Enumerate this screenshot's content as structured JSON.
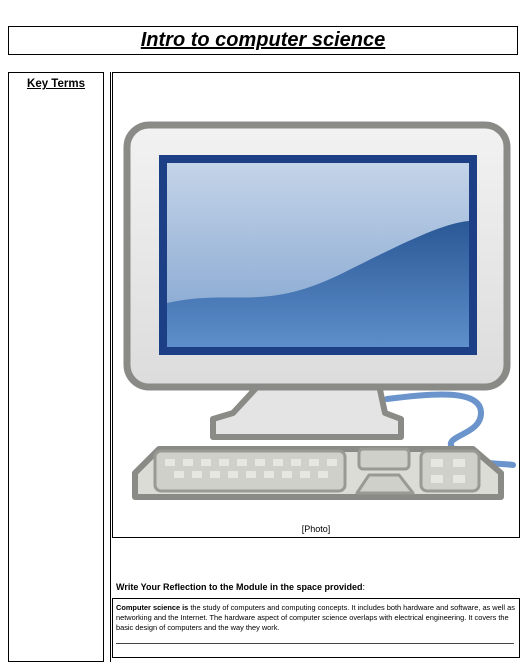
{
  "header": {
    "title": "Intro to computer science"
  },
  "sidebar": {
    "heading": "Key Terms"
  },
  "photo": {
    "caption": "[Photo]",
    "icon": "desktop-computer-illustration"
  },
  "reflection": {
    "prompt": "Write Your Reflection to the Module in the space provided",
    "prompt_suffix": ":",
    "term": "Computer science is",
    "text": " the study of computers and computing concepts. It includes both hardware and software, as well as networking and the Internet. The hardware aspect of computer science overlaps with electrical engineering. It covers the basic design of computers and the way they work."
  }
}
